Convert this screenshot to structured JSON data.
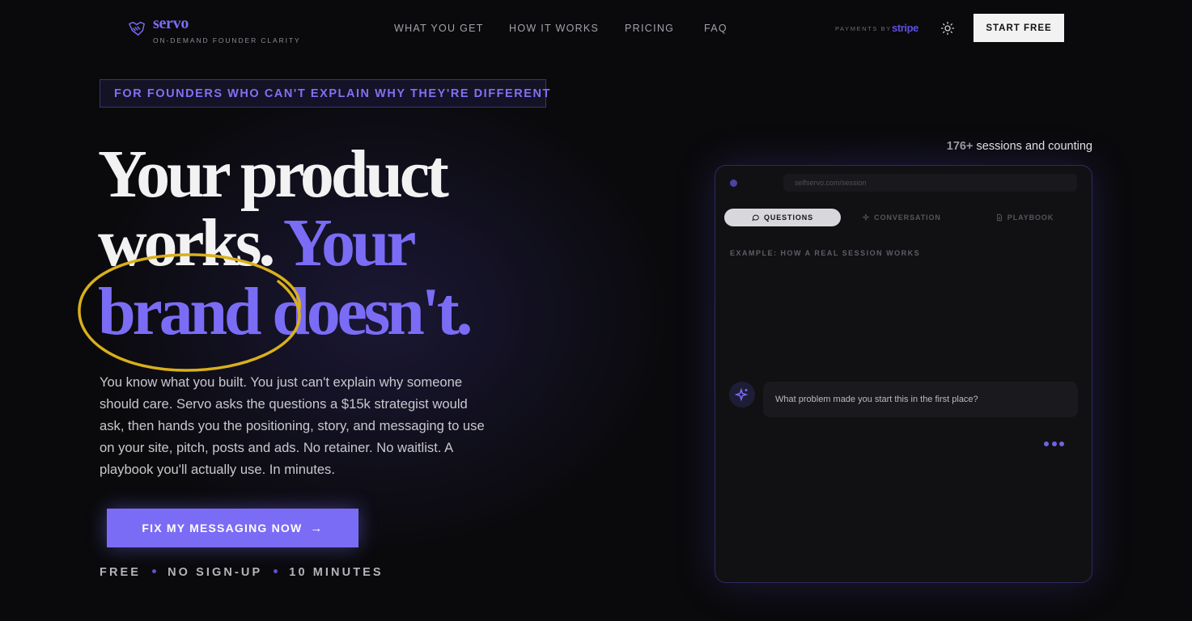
{
  "nav": {
    "brand": "servo",
    "tagline": "ON-DEMAND FOUNDER CLARITY",
    "links": [
      "WHAT YOU GET",
      "HOW IT WORKS",
      "PRICING",
      "FAQ"
    ],
    "payments_label": "PAYMENTS BY",
    "payments_brand": "stripe",
    "cta": "START FREE"
  },
  "hero": {
    "eyebrow": "FOR FOUNDERS WHO CAN'T EXPLAIN WHY THEY'RE DIFFERENT",
    "headline": {
      "line1": "Your product",
      "line2_white": "works.",
      "line2_purple": "Your",
      "line3": "brand doesn't."
    },
    "description": "You know what you built. You just can't explain why someone should care. Servo asks the questions a $15k strategist would ask, then hands you the positioning, story, and messaging to use on your site, pitch, posts and ads. No retainer. No waitlist. A playbook you'll actually use. In minutes.",
    "cta": "FIX MY MESSAGING NOW",
    "meta": [
      "FREE",
      "NO SIGN-UP",
      "10 MINUTES"
    ]
  },
  "mockup": {
    "sessions_count": "176+",
    "sessions_label": "sessions and counting",
    "url": "selfservo.com/session",
    "tabs": [
      {
        "label": "QUESTIONS",
        "icon": "chat-bubble-icon",
        "active": true
      },
      {
        "label": "CONVERSATION",
        "icon": "sparkles-icon",
        "active": false
      },
      {
        "label": "PLAYBOOK",
        "icon": "document-icon",
        "active": false
      }
    ],
    "example_label": "EXAMPLE: HOW A REAL SESSION WORKS",
    "question": "What problem made you start this in the first place?"
  },
  "colors": {
    "accent": "#7b6cf6",
    "background": "#0a0a0c",
    "highlight_circle": "#d9b01c"
  }
}
